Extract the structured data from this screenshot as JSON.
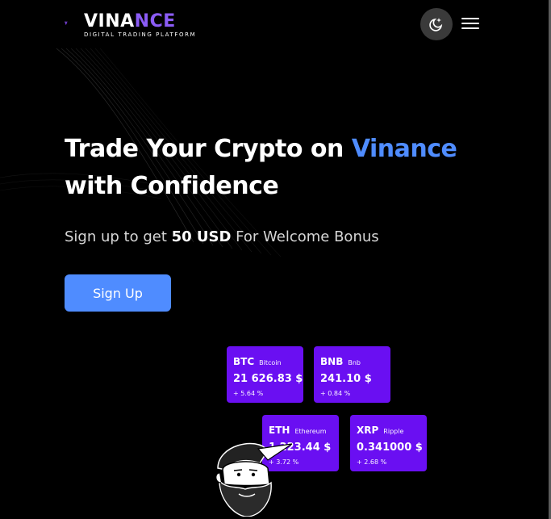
{
  "brand": {
    "name_part1": "VINA",
    "name_part2": "NCE",
    "tagline": "DIGITAL TRADING PLATFORM",
    "accent_color": "#8b5cf6"
  },
  "header": {
    "theme_toggle_icon": "moon-sparkle-icon",
    "menu_icon": "hamburger-menu-icon"
  },
  "hero": {
    "title_line1_part1": "Trade Your Crypto on ",
    "title_line1_accent": "Vinance",
    "title_line2": "with Confidence",
    "subtitle_part1": "Sign up to get ",
    "subtitle_bold": "50 USD",
    "subtitle_part2": " For Welcome Bonus",
    "cta_label": "Sign Up",
    "accent_color": "#4f8cff"
  },
  "tickers": [
    {
      "symbol": "BTC",
      "name": "Bitcoin",
      "price": "21 626.83 $",
      "change": "+ 5.64 %"
    },
    {
      "symbol": "BNB",
      "name": "Bnb",
      "price": "241.10 $",
      "change": "+ 0.84 %"
    },
    {
      "symbol": "ETH",
      "name": "Ethereum",
      "price": "1 223.44 $",
      "change": "+ 3.72 %"
    },
    {
      "symbol": "XRP",
      "name": "Ripple",
      "price": "0.341000 $",
      "change": "+ 2.68 %"
    }
  ],
  "card_color": "#6a0ff2"
}
